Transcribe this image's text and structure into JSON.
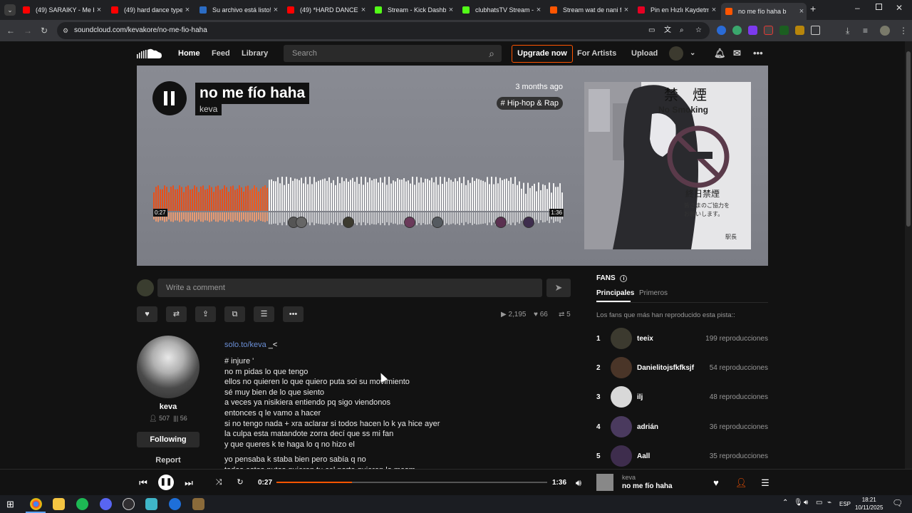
{
  "browser": {
    "tabs": [
      {
        "title": "(49) SARAIKY - Me bu",
        "fav": "#ff0000"
      },
      {
        "title": "(49) hard dance type",
        "fav": "#ff0000"
      },
      {
        "title": "Su archivo está listo!",
        "fav": "#2b6cc4"
      },
      {
        "title": "(49) *HARD DANCE*",
        "fav": "#ff0000"
      },
      {
        "title": "Stream - Kick Dashbo",
        "fav": "#53fc18"
      },
      {
        "title": "clubhatsTV Stream -",
        "fav": "#53fc18"
      },
      {
        "title": "Stream wat de nani fr",
        "fav": "#ff5500"
      },
      {
        "title": "Pin en Hızlı Kaydetme",
        "fav": "#e60023"
      },
      {
        "title": "no me fío haha b",
        "fav": "#ff5500",
        "active": true
      }
    ],
    "url": "soundcloud.com/kevakore/no-me-fio-haha"
  },
  "header": {
    "nav": [
      "Home",
      "Feed",
      "Library"
    ],
    "search_placeholder": "Search",
    "upgrade": "Upgrade now",
    "for_artists": "For Artists",
    "upload": "Upload"
  },
  "track": {
    "title": "no me fío haha",
    "artist": "keva",
    "posted": "3 months ago",
    "genre": "# Hip-hop & Rap",
    "current_time": "0:27",
    "duration": "1:36",
    "progress": 0.28,
    "artwork_text": {
      "kanji_top": "禁　煙",
      "no_smoking": "No Smoking",
      "kanji_mid": "終日禁煙",
      "kanji_small1": "皆さまのご協力を",
      "kanji_small2": "お願いします。",
      "station": "駅長"
    }
  },
  "comment": {
    "placeholder": "Write a comment"
  },
  "stats": {
    "plays": "2,195",
    "likes": "66",
    "reposts": "5"
  },
  "artist": {
    "name": "keva",
    "followers": "507",
    "tracks": "56",
    "following_label": "Following",
    "report_label": "Report"
  },
  "description": {
    "link": "solo.to/keva",
    "link_suffix": " _<",
    "lines": [
      "# injure '",
      "no m pidas lo que tengo",
      "ellos no quieren lo que quiero puta soi su movimiento",
      "sé muy bien de lo que siento",
      "a veces ya nisikiera entiendo pq sigo viendonos",
      "entonces q le vamo a hacer",
      "si no tengo nada + xra aclarar si todos hacen lo k ya hice ayer",
      "la culpa esta matandote zorra decí que ss mi fan",
      "y que queres k te haga lo q no hizo el"
    ],
    "lines2": [
      "yo pensaba k staba bien pero sabía q no",
      "todos estos putos quieren tu cel porte quieren lo mesm"
    ]
  },
  "fans": {
    "title": "FANS",
    "tabs": [
      "Principales",
      "Primeros"
    ],
    "subtitle": "Los fans que más han reproducido esta pista::",
    "list": [
      {
        "rank": "1",
        "name": "teeix",
        "plays": "199 reproducciones",
        "color": "#3c3a2f"
      },
      {
        "rank": "2",
        "name": "Danielitojsfkfksjf",
        "plays": "54 reproducciones",
        "color": "#4a3528"
      },
      {
        "rank": "3",
        "name": "ilj",
        "plays": "48 reproducciones",
        "color": "#d8d8d8"
      },
      {
        "rank": "4",
        "name": "adrián",
        "plays": "36 reproducciones",
        "color": "#4a3a5e"
      },
      {
        "rank": "5",
        "name": "Aall",
        "plays": "35 reproducciones",
        "color": "#3e2d4d"
      }
    ]
  },
  "player": {
    "current_time": "0:27",
    "duration": "1:36",
    "progress": 0.28,
    "artist": "keva",
    "track": "no me fío haha"
  },
  "taskbar": {
    "lang": "ESP",
    "time": "18:21",
    "date": "10/11/2025"
  },
  "colors": {
    "accent": "#ff5500",
    "bg": "#121212"
  }
}
